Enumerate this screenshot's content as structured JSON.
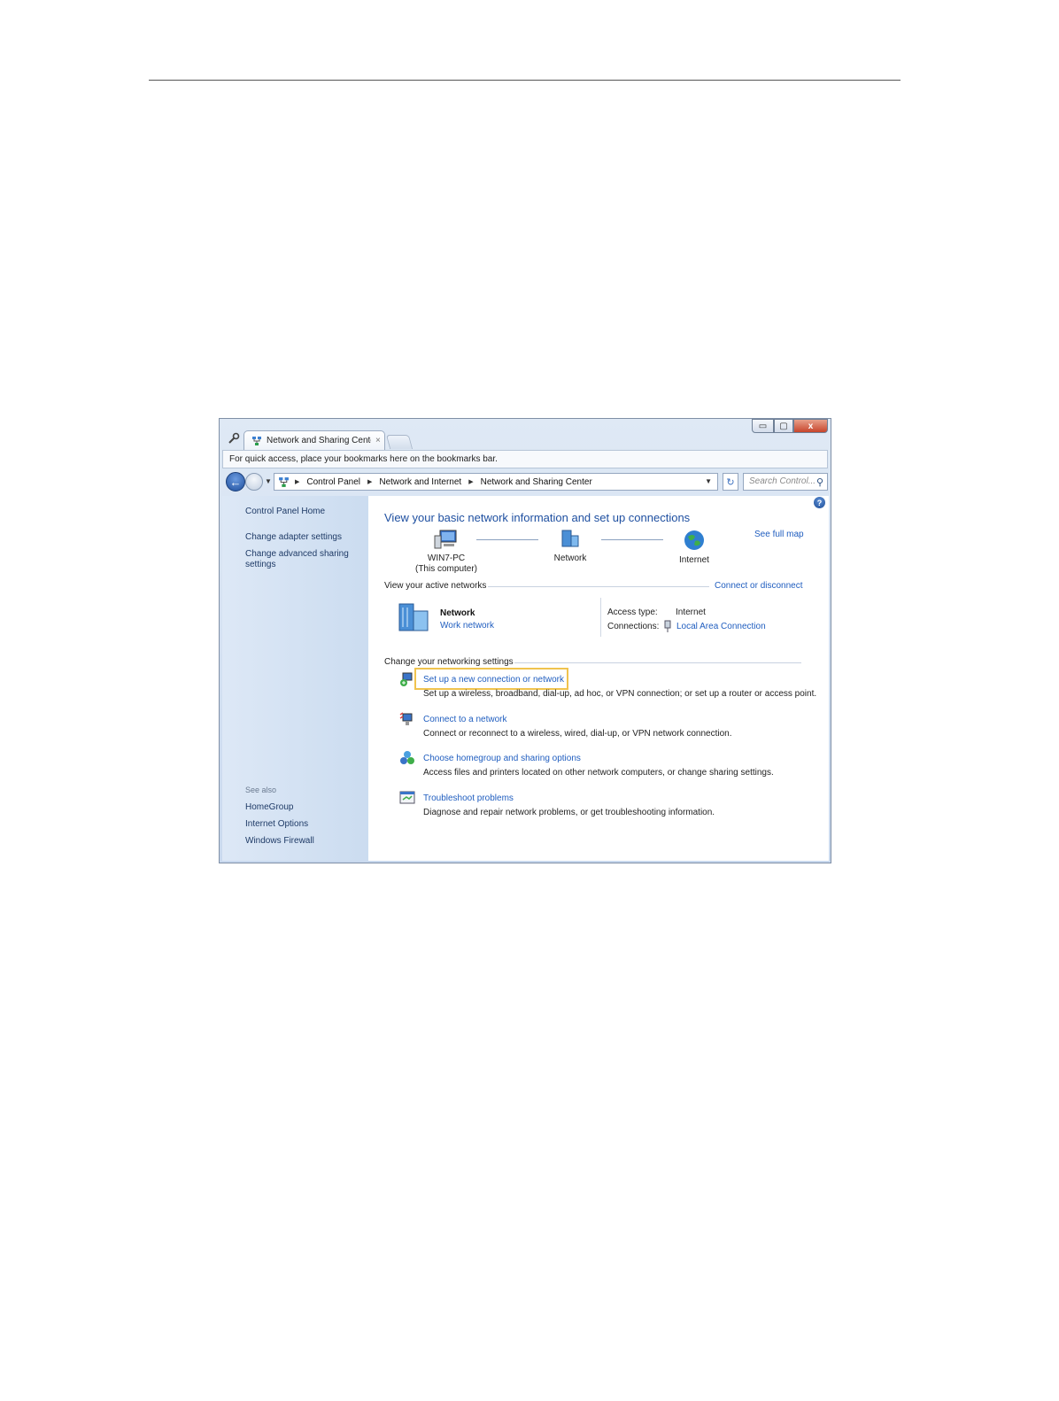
{
  "window": {
    "tab_title": "Network and Sharing Center",
    "tab_close": "×",
    "bookmark_bar_text": "For quick access, place your bookmarks here on the bookmarks bar.",
    "buttons": {
      "minimize": "▭",
      "maximize": "▢",
      "close": "x"
    }
  },
  "nav": {
    "back": "←",
    "breadcrumbs": [
      "Control Panel",
      "Network and Internet",
      "Network and Sharing Center"
    ],
    "search_placeholder": "Search Control..."
  },
  "sidebar": {
    "home": "Control Panel Home",
    "links": [
      "Change adapter settings",
      "Change advanced sharing settings"
    ],
    "see_also_label": "See also",
    "see_also": [
      "HomeGroup",
      "Internet Options",
      "Windows Firewall"
    ]
  },
  "main": {
    "title": "View your basic network information and set up connections",
    "see_full_map": "See full map",
    "map": {
      "computer": "WIN7-PC",
      "computer_sub": "(This computer)",
      "network": "Network",
      "internet": "Internet"
    },
    "active_networks_label": "View your active networks",
    "connect_or_disconnect": "Connect or disconnect",
    "active_network": {
      "name": "Network",
      "type": "Work network",
      "access_type_label": "Access type:",
      "access_type_value": "Internet",
      "connections_label": "Connections:",
      "connections_value": "Local Area Connection"
    },
    "settings_label": "Change your networking settings",
    "tasks": [
      {
        "title": "Set up a new connection or network",
        "desc": "Set up a wireless, broadband, dial-up, ad hoc, or VPN connection; or set up a router or access point."
      },
      {
        "title": "Connect to a network",
        "desc": "Connect or reconnect to a wireless, wired, dial-up, or VPN network connection."
      },
      {
        "title": "Choose homegroup and sharing options",
        "desc": "Access files and printers located on other network computers, or change sharing settings."
      },
      {
        "title": "Troubleshoot problems",
        "desc": "Diagnose and repair network problems, or get troubleshooting information."
      }
    ]
  },
  "colors": {
    "link": "#1f5dbf",
    "title": "#1e4fa0",
    "highlight": "#f0c34e"
  }
}
